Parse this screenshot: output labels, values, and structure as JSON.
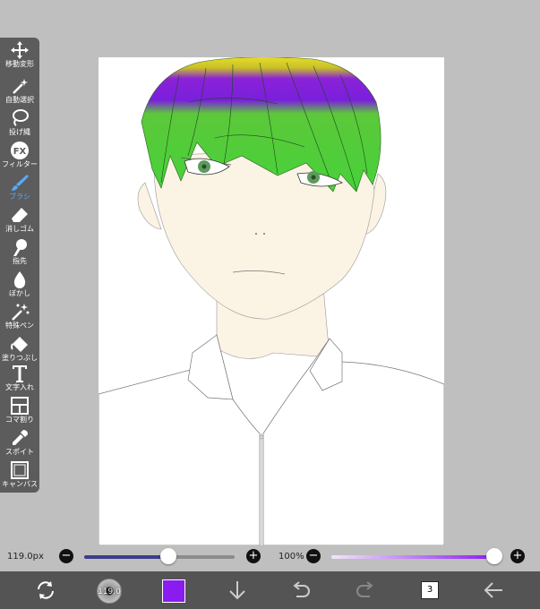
{
  "toolbar": {
    "tools": [
      {
        "label": "移動変形",
        "icon": "move-arrows-icon"
      },
      {
        "label": "自動選択",
        "icon": "magic-wand-icon"
      },
      {
        "label": "投げ縄",
        "icon": "lasso-icon"
      },
      {
        "label": "フィルター",
        "icon": "fx-icon"
      },
      {
        "label": "ブラシ",
        "icon": "brush-icon"
      },
      {
        "label": "消しゴム",
        "icon": "eraser-icon"
      },
      {
        "label": "指先",
        "icon": "finger-icon"
      },
      {
        "label": "ぼかし",
        "icon": "blur-drop-icon"
      },
      {
        "label": "特殊ペン",
        "icon": "special-pen-icon"
      },
      {
        "label": "塗りつぶし",
        "icon": "fill-bucket-icon"
      },
      {
        "label": "文字入れ",
        "icon": "text-icon"
      },
      {
        "label": "コマ割り",
        "icon": "panel-icon"
      },
      {
        "label": "スポイト",
        "icon": "eyedropper-icon"
      },
      {
        "label": "キャンバス",
        "icon": "canvas-icon"
      }
    ],
    "active_tool": "ブラシ",
    "active_color": "#5aa9ff"
  },
  "brush_size": {
    "value": "119.0px",
    "fill_fraction": 0.56
  },
  "opacity": {
    "value": "100%",
    "fill_fraction": 1.0
  },
  "bottom": {
    "brush_preview_label": "119.0",
    "current_color": "#8b1cf0",
    "layer_count": "3"
  },
  "colors": {
    "hair_green": "#4ed23a",
    "hair_purple": "#7a1fdc",
    "hair_yellow": "#e6dc2a",
    "skin": "#fbf3e4",
    "eye": "#5d9a5d"
  }
}
